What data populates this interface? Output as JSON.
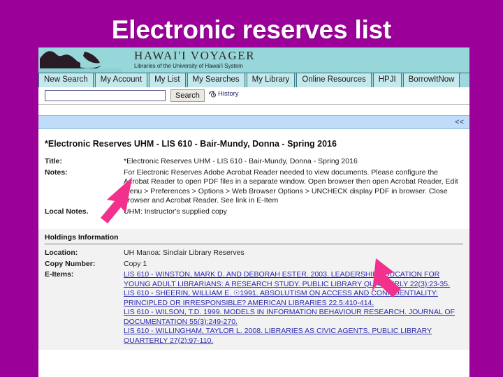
{
  "slide": {
    "title": "Electronic reserves list",
    "background_color": "#9b0099",
    "rule_color": "#f3c9ef"
  },
  "banner": {
    "logo_icon": "hawaii-voyager-wave-logo",
    "title": "HAWAI'I VOYAGER",
    "subtitle": "Libraries of the University of Hawai'i System",
    "background_color": "#97d7da"
  },
  "nav": {
    "tabs": [
      {
        "label": "New Search"
      },
      {
        "label": "My Account"
      },
      {
        "label": "My List"
      },
      {
        "label": "My Searches"
      },
      {
        "label": "My Library"
      },
      {
        "label": "Online Resources"
      },
      {
        "label": "HPJI"
      },
      {
        "label": "BorrowItNow"
      }
    ]
  },
  "search": {
    "value": "",
    "placeholder": "",
    "button_label": "Search",
    "history_label": "History",
    "history_icon": "history-clock-arrow-icon"
  },
  "toolbar": {
    "prev_label": "<<",
    "background_color": "#bfdcf8"
  },
  "record": {
    "heading": "*Electronic Reserves UHM - LIS 610 - Bair-Mundy, Donna - Spring 2016",
    "fields": [
      {
        "label": "Title:",
        "value": "*Electronic Reserves UHM - LIS 610 - Bair-Mundy, Donna - Spring 2016"
      },
      {
        "label": "Notes:",
        "value": "For Electronic Reserves Adobe Acrobat Reader needed to view documents. Please configure the Acrobat Reader to open PDF files in a separate window. Open browser then open Acrobat Reader, Edit menu > Preferences > Options > Web Browser Options > UNCHECK display PDF in browser. Close browser and Acrobat Reader. See link in E-Item"
      },
      {
        "label": "Local Notes.",
        "value": "UHM: Instructor's supplied copy"
      }
    ]
  },
  "holdings": {
    "title": "Holdings Information",
    "fields": [
      {
        "label": "Location:",
        "value": "UH Manoa: Sinclair Library Reserves"
      },
      {
        "label": "Copy Number:",
        "value": "Copy 1"
      }
    ],
    "eitems_label": "E-Items:",
    "eitems": [
      "LIS 610 - WINSTON, MARK D. AND DEBORAH  ESTER. 2003. LEADERSHIP EDUCATION FOR YOUNG ADULT LIBRARIANS: A RESEARCH STUDY. PUBLIC LIBRARY QUARTERLY 22(3):23-35.",
      "LIS 610 - SHEERIN, WILLIAM E. ☉1991. ABSOLUTISM ON ACCESS AND CONFIDENTIALITY: PRINCIPLED OR IRRESPONSIBLE? AMERICAN LIBRARIES 22.5:410-414.",
      "LIS 610 - WILSON, T.D. 1999. MODELS IN INFORMATION BEHAVIOUR RESEARCH. JOURNAL OF DOCUMENTATION 55(3):249-270.",
      "LIS 610 - WILLINGHAM, TAYLOR L. 2008. LIBRARIES AS CIVIC AGENTS. PUBLIC LIBRARY QUARTERLY 27(2):97-110."
    ]
  },
  "annotations": {
    "arrow_color": "#f2318c",
    "arrows": [
      {
        "name": "arrow-pointing-to-notes",
        "direction": "up-right"
      },
      {
        "name": "arrow-pointing-to-eitems",
        "direction": "down-left"
      }
    ]
  }
}
